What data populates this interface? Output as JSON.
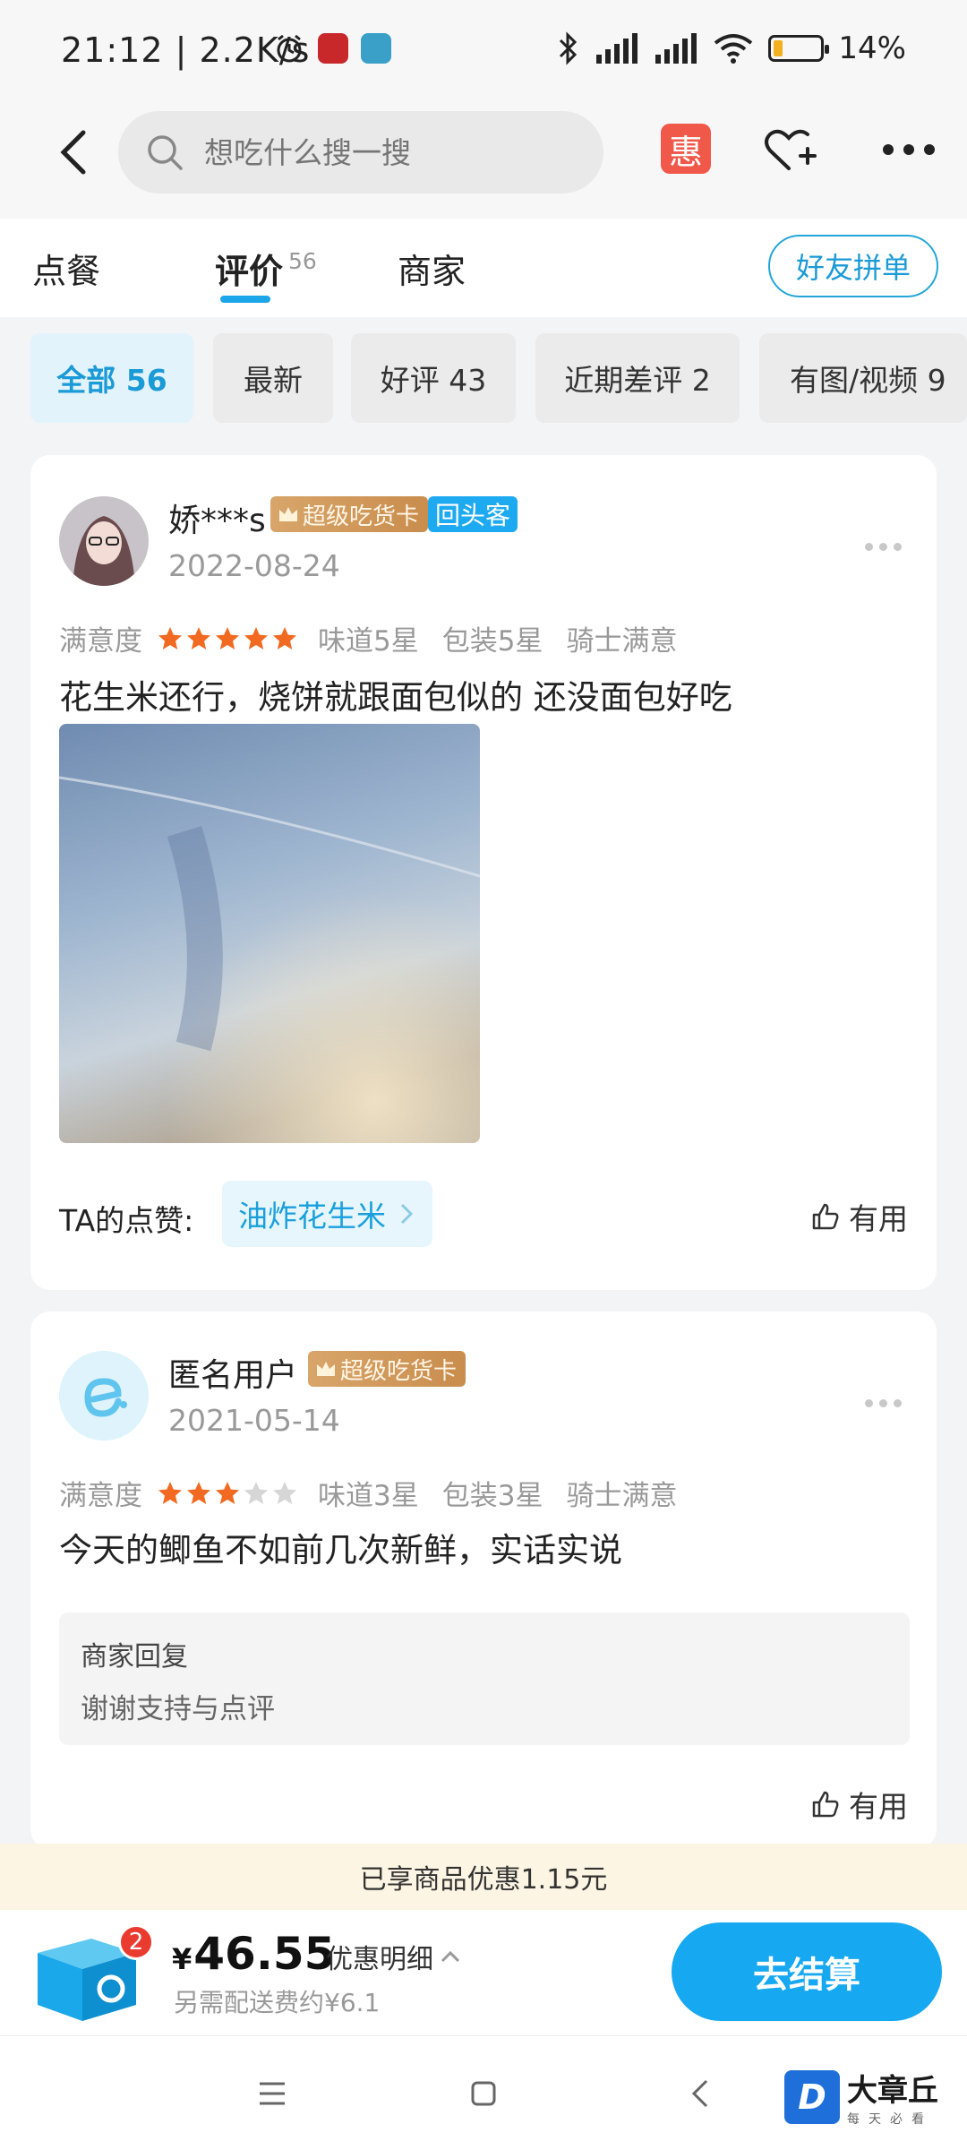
{
  "status_bar": {
    "time_speed": "21:12 | 2.2K/s",
    "battery": "14%"
  },
  "header": {
    "search_placeholder": "想吃什么搜一搜",
    "hui_label": "惠"
  },
  "tabs": {
    "items": [
      {
        "label": "点餐"
      },
      {
        "label": "评价",
        "count": "56"
      },
      {
        "label": "商家"
      }
    ],
    "friend_button": "好友拼单"
  },
  "filters": [
    {
      "label": "全部 56"
    },
    {
      "label": "最新"
    },
    {
      "label": "好评 43"
    },
    {
      "label": "近期差评 2"
    },
    {
      "label": "有图/视频 9"
    }
  ],
  "reviews": [
    {
      "user": "娇***s",
      "badge_gold": "超级吃货卡",
      "badge_blue": "回头客",
      "date": "2022-08-24",
      "rating_label": "满意度",
      "stars": 5,
      "taste": "味道5星",
      "packaging": "包装5星",
      "rider": "骑士满意",
      "text": "花生米还行，烧饼就跟面包似的 还没面包好吃",
      "liked_label": "TA的点赞:",
      "liked_item": "油炸花生米",
      "useful": "有用"
    },
    {
      "user": "匿名用户",
      "badge_gold": "超级吃货卡",
      "date": "2021-05-14",
      "rating_label": "满意度",
      "stars": 3,
      "taste": "味道3星",
      "packaging": "包装3星",
      "rider": "骑士满意",
      "text": "今天的鲫鱼不如前几次新鲜，实话实说",
      "reply_title": "商家回复",
      "reply_text": "谢谢支持与点评",
      "useful": "有用"
    }
  ],
  "checkout": {
    "discount_notice": "已享商品优惠1.15元",
    "cart_count": "2",
    "currency": "¥",
    "price": "46.55",
    "discount_detail": "优惠明细",
    "delivery_fee": "另需配送费约¥6.1",
    "pay_button": "去结算"
  },
  "watermark": {
    "logo_letter": "D",
    "name": "大章丘",
    "slogan": "每天必看"
  },
  "colors": {
    "accent": "#16a8f0",
    "star_on": "#f26a21",
    "star_off": "#d6d6d6",
    "badge_gold": "#d8a56a"
  }
}
